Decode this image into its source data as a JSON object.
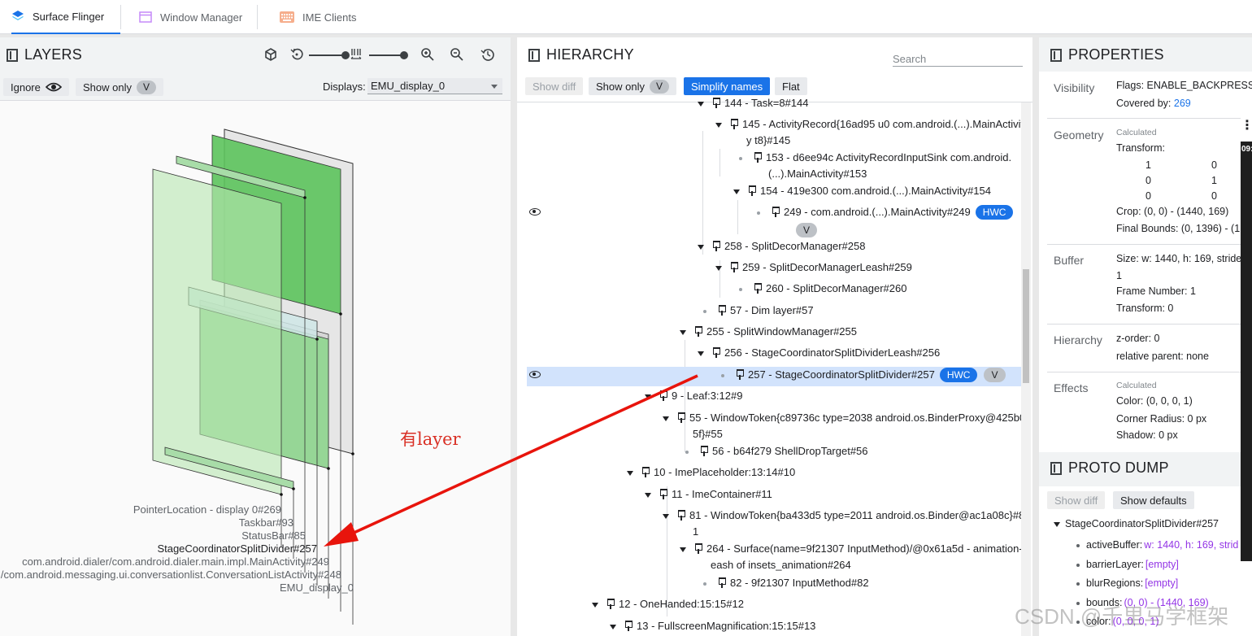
{
  "tabs": [
    {
      "label": "Surface Flinger",
      "active": true,
      "icon": "layers-icon"
    },
    {
      "label": "Window Manager",
      "active": false,
      "icon": "window-icon"
    },
    {
      "label": "IME Clients",
      "active": false,
      "icon": "keyboard-icon"
    }
  ],
  "layers": {
    "title": "LAYERS",
    "ignore_label": "Ignore",
    "show_only_label": "Show only",
    "v_label": "V",
    "displays_label": "Displays:",
    "display_value": "EMU_display_0",
    "labels": [
      "PointerLocation - display 0#269",
      "Taskbar#93",
      "StatusBar#85",
      "StageCoordinatorSplitDivider#257",
      "com.android.dialer/com.android.dialer.main.impl.MainActivity#249",
      "g/com.android.messaging.ui.conversationlist.ConversationListActivity#248",
      "EMU_display_0"
    ]
  },
  "hierarchy": {
    "title": "HIERARCHY",
    "search_placeholder": "Search",
    "show_diff": "Show diff",
    "show_only": "Show only",
    "v_label": "V",
    "simplify_names": "Simplify names",
    "flat": "Flat",
    "hwc": "HWC",
    "rows": [
      "144 - Task=8#144",
      "145 - ActivityRecord{16ad95 u0 com.android.(...).MainActivit",
      "y t8}#145",
      "153 - d6ee94c ActivityRecordInputSink com.android.",
      "(...).MainActivity#153",
      "154 - 419e300 com.android.(...).MainActivity#154",
      "249 - com.android.(...).MainActivity#249",
      "258 - SplitDecorManager#258",
      "259 - SplitDecorManagerLeash#259",
      "260 - SplitDecorManager#260",
      "57 - Dim layer#57",
      "255 - SplitWindowManager#255",
      "256 - StageCoordinatorSplitDividerLeash#256",
      "257 - StageCoordinatorSplitDivider#257",
      "9 - Leaf:3:12#9",
      "55 - WindowToken{c89736c type=2038 android.os.BinderProxy@425b0",
      "5f}#55",
      "56 - b64f279 ShellDropTarget#56",
      "10 - ImePlaceholder:13:14#10",
      "11 - ImeContainer#11",
      "81 - WindowToken{ba433d5 type=2011 android.os.Binder@ac1a08c}#8",
      "1",
      "264 - Surface(name=9f21307 InputMethod)/@0x61a5d - animation-l",
      "eash of insets_animation#264",
      "82 - 9f21307 InputMethod#82",
      "12 - OneHanded:15:15#12",
      "13 - FullscreenMagnification:15:15#13"
    ]
  },
  "properties": {
    "title": "PROPERTIES",
    "visibility_label": "Visibility",
    "flags": "Flags: ENABLE_BACKPRESS",
    "covered_by_label": "Covered by:",
    "covered_by_value": "269",
    "geometry_label": "Geometry",
    "calculated": "Calculated",
    "transform_label": "Transform:",
    "matrix": [
      "1",
      "0",
      "0",
      "1",
      "0",
      "0"
    ],
    "crop": "Crop: (0, 0) - (1440, 169)",
    "final_bounds": "Final Bounds: (0, 1396) - (1",
    "buffer_label": "Buffer",
    "size": "Size: w: 1440, h: 169, stride",
    "size_cont": "1",
    "frame_number": "Frame Number: 1",
    "buffer_transform": "Transform: 0",
    "hierarchy_label": "Hierarchy",
    "z_order": "z-order: 0",
    "relative_parent": "relative parent: none",
    "effects_label": "Effects",
    "color": "Color: (0, 0, 0, 1)",
    "corner_radius": "Corner Radius: 0 px",
    "shadow": "Shadow: 0 px"
  },
  "proto": {
    "title": "PROTO DUMP",
    "show_diff": "Show diff",
    "show_defaults": "Show defaults",
    "root": "StageCoordinatorSplitDivider#257",
    "entries": [
      {
        "key": "activeBuffer:",
        "value": "w: 1440, h: 169, strid"
      },
      {
        "key": "barrierLayer:",
        "value": "[empty]"
      },
      {
        "key": "blurRegions:",
        "value": "[empty]"
      },
      {
        "key": "bounds:",
        "value": "(0, 0) - (1440, 169)"
      },
      {
        "key": "color:",
        "value": "(0, 0, 0, 1)"
      }
    ]
  },
  "annotation": "有layer",
  "watermark": "CSDN @千里马学框架",
  "clock": "09:"
}
